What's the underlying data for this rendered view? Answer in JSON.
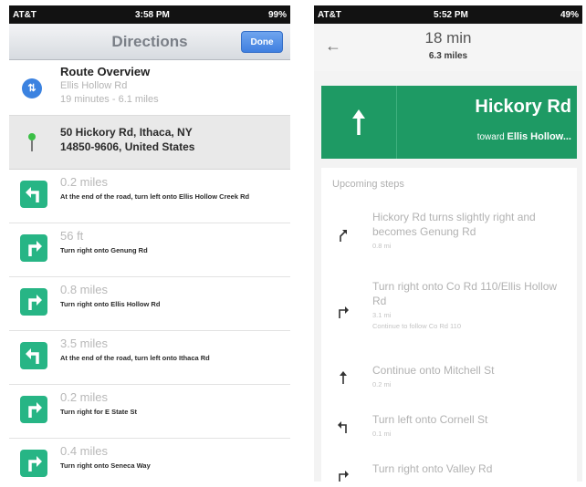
{
  "left_phone": {
    "status": {
      "carrier": "AT&T",
      "time": "3:58 PM",
      "battery": "99%"
    },
    "nav": {
      "title": "Directions",
      "done_label": "Done"
    },
    "overview": {
      "title": "Route Overview",
      "road": "Ellis Hollow Rd",
      "summary": "19 minutes - 6.1 miles"
    },
    "destination": {
      "line1": "50 Hickory Rd, Ithaca, NY",
      "line2": "14850-9606, United States"
    },
    "steps": [
      {
        "distance": "0.2 miles",
        "instruction": "At the end of the road, turn left onto Ellis Hollow Creek Rd",
        "icon": "turn-left-icon"
      },
      {
        "distance": "56 ft",
        "instruction": "Turn right onto Genung Rd",
        "icon": "turn-right-icon"
      },
      {
        "distance": "0.8 miles",
        "instruction": "Turn right onto Ellis Hollow Rd",
        "icon": "turn-right-icon"
      },
      {
        "distance": "3.5 miles",
        "instruction": "At the end of the road, turn left onto Ithaca Rd",
        "icon": "turn-left-icon"
      },
      {
        "distance": "0.2 miles",
        "instruction": "Turn right for E State St",
        "icon": "turn-right-icon"
      },
      {
        "distance": "0.4 miles",
        "instruction": "Turn right onto Seneca Way",
        "icon": "turn-right-icon"
      }
    ],
    "colors": {
      "step_icon": "#27b585",
      "done_button": "#3f7fe0"
    }
  },
  "right_phone": {
    "status": {
      "carrier": "AT&T",
      "time": "5:52 PM",
      "battery": "49%"
    },
    "header": {
      "duration": "18 min",
      "distance": "6.3 miles"
    },
    "banner": {
      "street": "Hickory Rd",
      "toward_prefix": "toward",
      "toward_road": "Ellis Hollow..."
    },
    "upcoming_label": "Upcoming steps",
    "steps": [
      {
        "text": "Hickory Rd turns slightly right and becomes Genung Rd",
        "distance": "0.8 mi",
        "extra": "",
        "icon": "slight-right-icon"
      },
      {
        "text": "Turn right onto Co Rd 110/Ellis Hollow Rd",
        "distance": "3.1 mi",
        "extra": "Continue to follow Co Rd 110",
        "icon": "turn-right-icon"
      },
      {
        "text": "Continue onto Mitchell St",
        "distance": "0.2 mi",
        "extra": "",
        "icon": "straight-arrow-icon"
      },
      {
        "text": "Turn left onto Cornell St",
        "distance": "0.1 mi",
        "extra": "",
        "icon": "turn-left-icon"
      },
      {
        "text": "Turn right onto Valley Rd",
        "distance": "",
        "extra": "",
        "icon": "turn-right-icon"
      }
    ],
    "colors": {
      "banner": "#1e9a64"
    }
  }
}
